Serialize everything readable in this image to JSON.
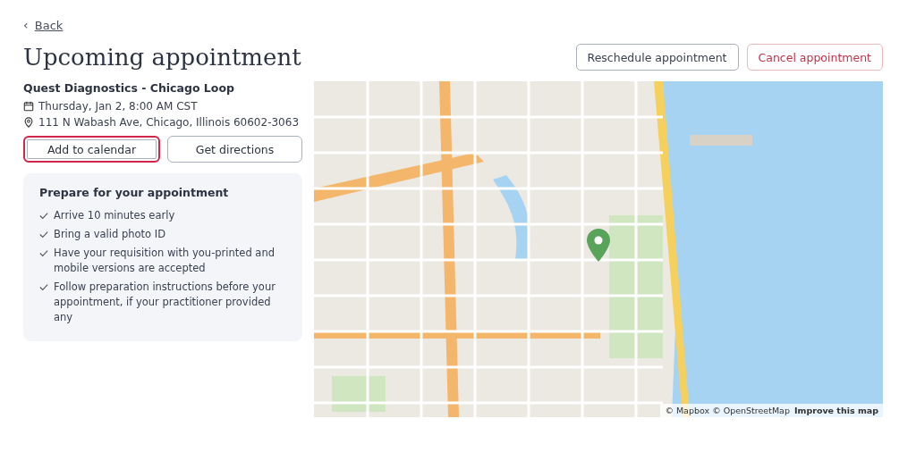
{
  "back_link": {
    "icon": "‹",
    "label": "Back"
  },
  "title": "Upcoming appointment",
  "header_actions": [
    {
      "label": "Reschedule appointment",
      "kind": "secondary"
    },
    {
      "label": "Cancel appointment",
      "kind": "danger"
    }
  ],
  "location": {
    "name": "Quest Diagnostics - Chicago Loop",
    "date": "Thursday, Jan 2, 8:00 AM CST",
    "address": "111 N Wabash Ave, Chicago, Illinois 60602-3063"
  },
  "actions": [
    {
      "label": "Add to calendar",
      "focused": true
    },
    {
      "label": "Get directions",
      "focused": false
    }
  ],
  "preparation": {
    "title": "Prepare for your appointment",
    "items": [
      "Arrive 10 minutes early",
      "Bring a valid photo ID",
      "Have your requisition with you-printed and mobile versions are accepted",
      "Follow preparation instructions before your appointment, if your practitioner provided any"
    ]
  },
  "map": {
    "attribution": "© Mapbox © OpenStreetMap",
    "improve_link": "Improve this map"
  }
}
